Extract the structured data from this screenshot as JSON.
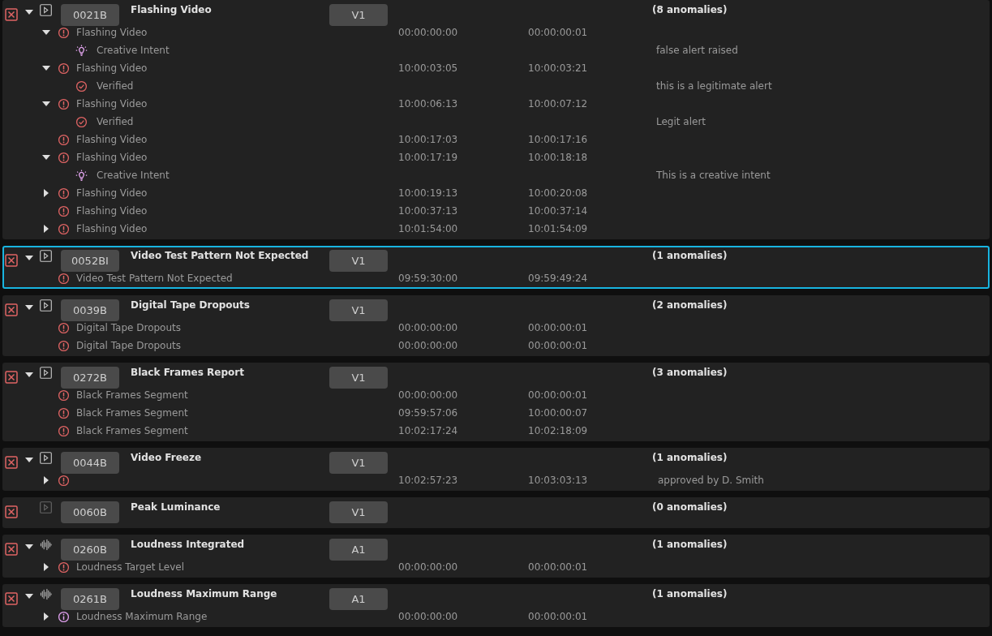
{
  "groups": [
    {
      "code": "0021B",
      "title": "Flashing Video",
      "track": "V1",
      "count": "(8 anomalies)",
      "expanded": true,
      "kind": "video",
      "media_enabled": true,
      "selected": false,
      "anomalies": [
        {
          "kind": "alert",
          "expanded": true,
          "label": "Flashing Video",
          "start": "00:00:00:00",
          "end": "00:00:00:01",
          "children": [
            {
              "kind": "creative",
              "label": "Creative Intent",
              "note": "false alert raised"
            }
          ]
        },
        {
          "kind": "alert",
          "expanded": true,
          "label": "Flashing Video",
          "start": "10:00:03:05",
          "end": "10:00:03:21",
          "children": [
            {
              "kind": "verified",
              "label": "Verified",
              "note": "this is a legitimate alert"
            }
          ]
        },
        {
          "kind": "alert",
          "expanded": true,
          "label": "Flashing Video",
          "start": "10:00:06:13",
          "end": "10:00:07:12",
          "children": [
            {
              "kind": "verified",
              "label": "Verified",
              "note": "Legit alert"
            }
          ]
        },
        {
          "kind": "alert",
          "label": "Flashing Video",
          "start": "10:00:17:03",
          "end": "10:00:17:16"
        },
        {
          "kind": "alert",
          "expanded": true,
          "label": "Flashing Video",
          "start": "10:00:17:19",
          "end": "10:00:18:18",
          "children": [
            {
              "kind": "creative",
              "label": "Creative Intent",
              "note": "This is a creative intent"
            }
          ]
        },
        {
          "kind": "alert",
          "expanded": false,
          "label": "Flashing Video",
          "start": "10:00:19:13",
          "end": "10:00:20:08"
        },
        {
          "kind": "alert",
          "label": "Flashing Video",
          "start": "10:00:37:13",
          "end": "10:00:37:14"
        },
        {
          "kind": "alert",
          "expanded": false,
          "label": "Flashing Video",
          "start": "10:01:54:00",
          "end": "10:01:54:09"
        }
      ]
    },
    {
      "code": "0052BI",
      "title": "Video Test Pattern Not Expected",
      "track": "V1",
      "count": "(1 anomalies)",
      "expanded": true,
      "kind": "video",
      "media_enabled": true,
      "selected": true,
      "anomalies": [
        {
          "kind": "alert",
          "label": "Video Test Pattern Not Expected",
          "start": "09:59:30:00",
          "end": "09:59:49:24"
        }
      ]
    },
    {
      "code": "0039B",
      "title": "Digital Tape Dropouts",
      "track": "V1",
      "count": "(2 anomalies)",
      "expanded": true,
      "kind": "video",
      "media_enabled": true,
      "selected": false,
      "anomalies": [
        {
          "kind": "alert",
          "label": "Digital Tape Dropouts",
          "start": "00:00:00:00",
          "end": "00:00:00:01"
        },
        {
          "kind": "alert",
          "label": "Digital Tape Dropouts",
          "start": "00:00:00:00",
          "end": "00:00:00:01"
        }
      ]
    },
    {
      "code": "0272B",
      "title": "Black Frames Report",
      "track": "V1",
      "count": "(3 anomalies)",
      "expanded": true,
      "kind": "video",
      "media_enabled": true,
      "selected": false,
      "anomalies": [
        {
          "kind": "alert",
          "label": "Black Frames Segment",
          "start": "00:00:00:00",
          "end": "00:00:00:01"
        },
        {
          "kind": "alert",
          "label": "Black Frames Segment",
          "start": "09:59:57:06",
          "end": "10:00:00:07"
        },
        {
          "kind": "alert",
          "label": "Black Frames Segment",
          "start": "10:02:17:24",
          "end": "10:02:18:09"
        }
      ]
    },
    {
      "code": "0044B",
      "title": "Video Freeze",
      "track": "V1",
      "count": "(1 anomalies)",
      "expanded": true,
      "kind": "video",
      "media_enabled": true,
      "selected": false,
      "anomalies": [
        {
          "kind": "alert",
          "expanded": false,
          "start": "10:02:57:23",
          "end": "10:03:03:13",
          "note": "approved by D. Smith"
        }
      ]
    },
    {
      "code": "0060B",
      "title": "Peak Luminance",
      "track": "V1",
      "count": "(0 anomalies)",
      "kind": "video",
      "media_enabled": false,
      "selected": false
    },
    {
      "code": "0260B",
      "title": "Loudness Integrated",
      "track": "A1",
      "count": "(1 anomalies)",
      "expanded": true,
      "kind": "audio",
      "media_enabled": true,
      "selected": false,
      "anomalies": [
        {
          "kind": "alert",
          "expanded": false,
          "label": "Loudness Target Level",
          "start": "00:00:00:00",
          "end": "00:00:00:01"
        }
      ]
    },
    {
      "code": "0261B",
      "title": "Loudness Maximum Range",
      "track": "A1",
      "count": "(1 anomalies)",
      "expanded": true,
      "kind": "audio",
      "media_enabled": true,
      "selected": false,
      "anomalies": [
        {
          "kind": "info",
          "expanded": false,
          "label": "Loudness Maximum Range",
          "start": "00:00:00:00",
          "end": "00:00:00:01"
        }
      ]
    }
  ]
}
